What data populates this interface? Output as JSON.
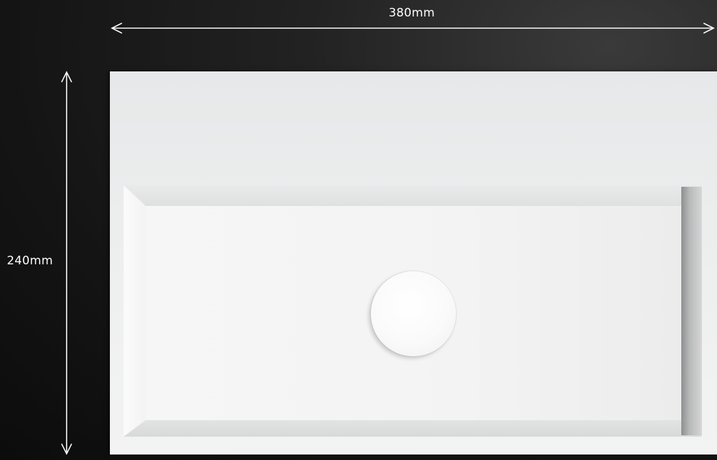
{
  "dimensions": {
    "width_label": "380mm",
    "height_label": "240mm"
  },
  "product": {
    "surface_color": "#f3f3f3",
    "background_color": "#141414",
    "annotation_color": "#ffffff"
  }
}
